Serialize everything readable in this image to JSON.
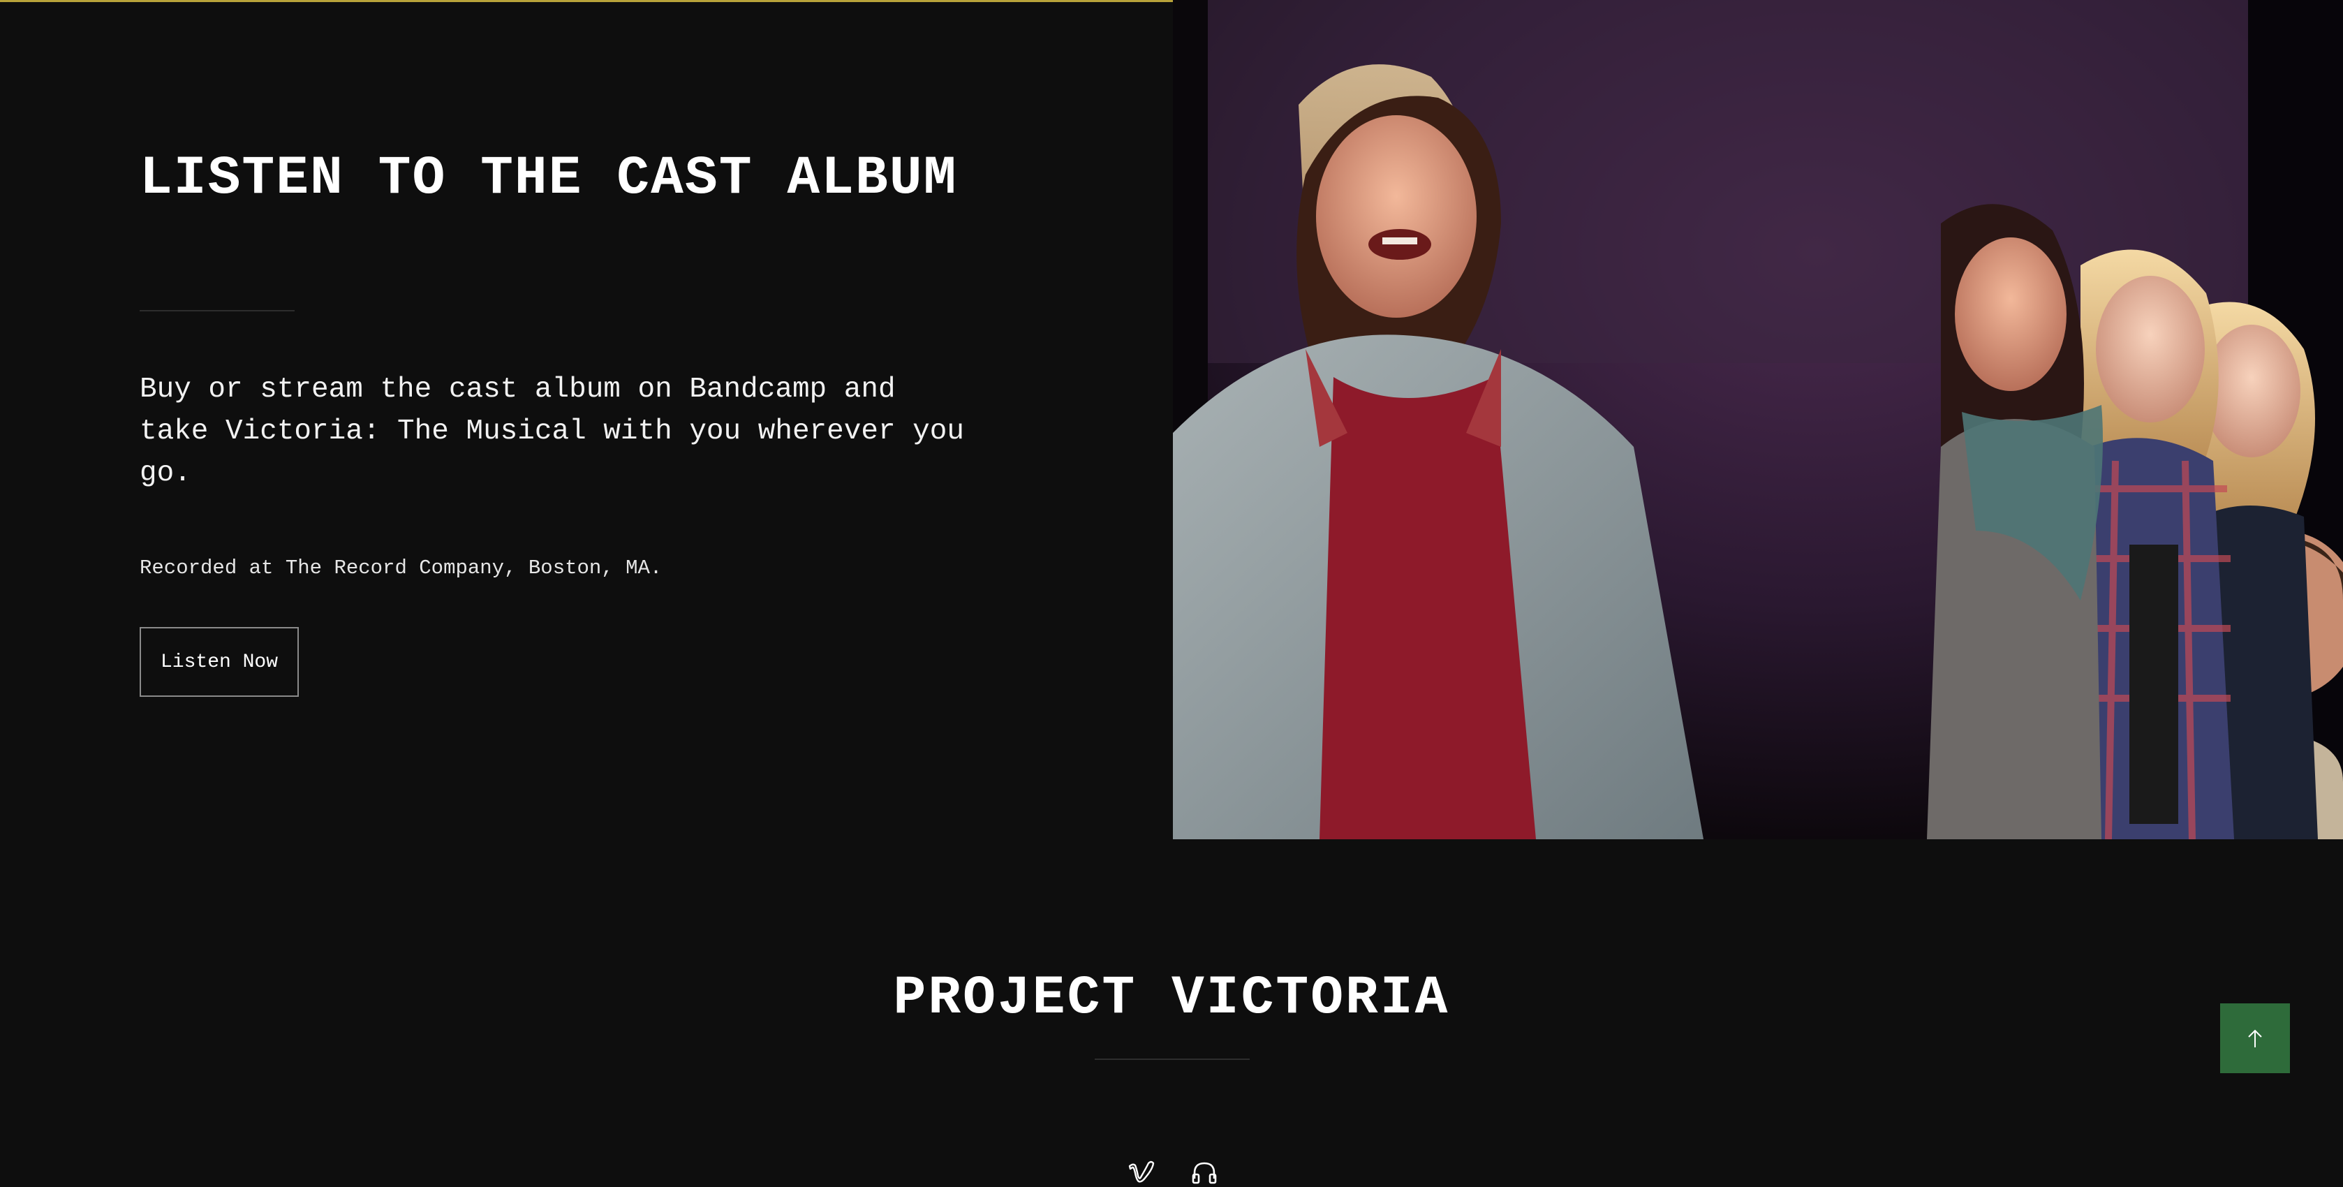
{
  "hero": {
    "title": "LISTEN TO THE CAST ALBUM",
    "description": "Buy or stream the cast album on Bandcamp and take Victoria: The Musical with you wherever you go.",
    "note": "Recorded at The Record Company, Boston, MA.",
    "button_label": "Listen Now",
    "accent_color": "#b8a23a"
  },
  "project": {
    "title": "PROJECT VICTORIA",
    "social_icons": [
      "vimeo-icon",
      "headphones-icon"
    ]
  },
  "back_to_top": {
    "icon": "arrow-up-icon",
    "color": "#2e6b3a"
  }
}
